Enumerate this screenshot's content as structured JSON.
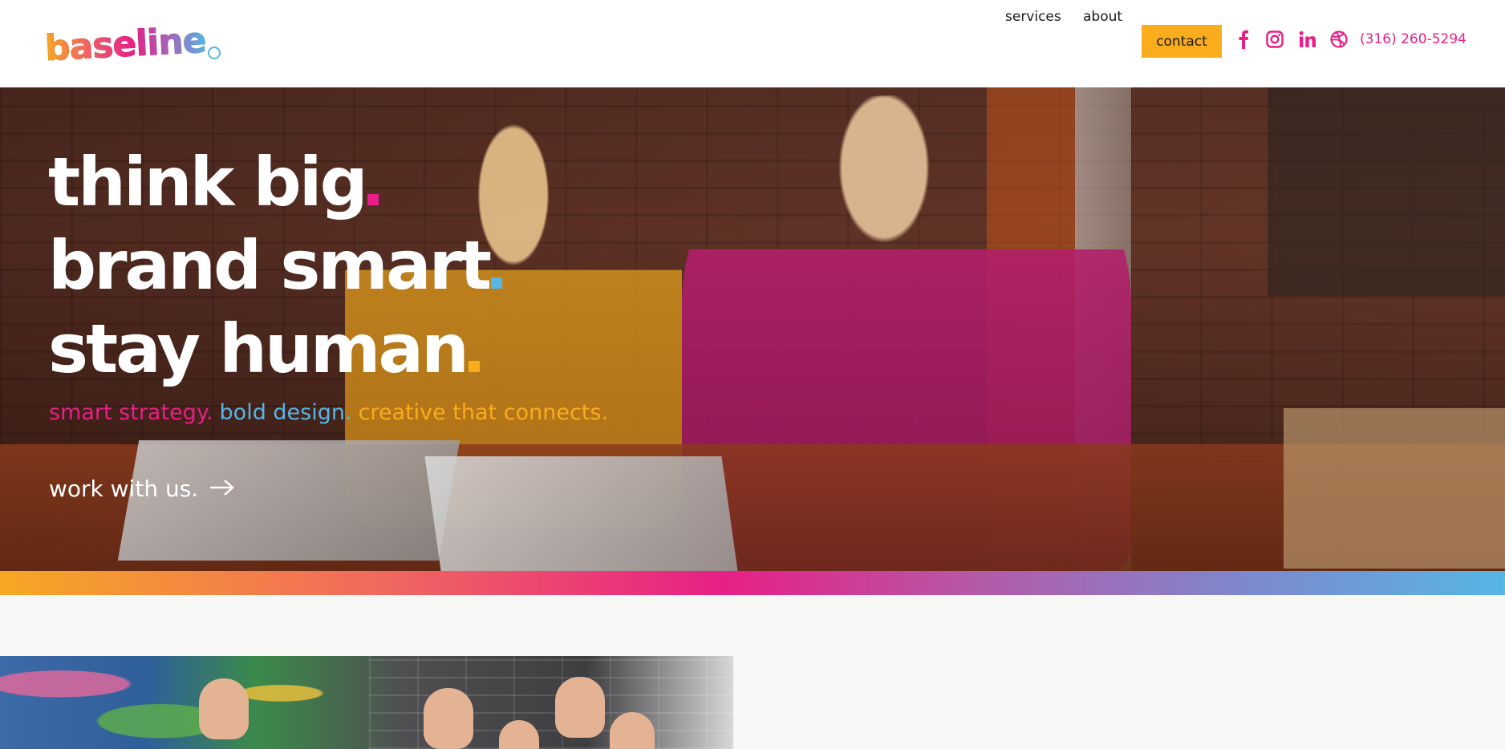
{
  "header": {
    "logo_text": "baseline",
    "nav": {
      "services_label": "services",
      "about_label": "about",
      "contact_label": "contact"
    },
    "social": [
      "facebook-icon",
      "instagram-icon",
      "linkedin-icon",
      "dribbble-icon"
    ],
    "phone": "(316) 260-5294"
  },
  "hero": {
    "headline": [
      "think big",
      "brand smart",
      "stay human"
    ],
    "tagline": {
      "part1": "smart strategy.",
      "part2": "bold design.",
      "part3": "creative that connects."
    },
    "cta_label": "work with us."
  },
  "colors": {
    "pink": "#e81f86",
    "blue": "#56b6e6",
    "yellow": "#f9ac1c",
    "orange": "#f7a823"
  }
}
